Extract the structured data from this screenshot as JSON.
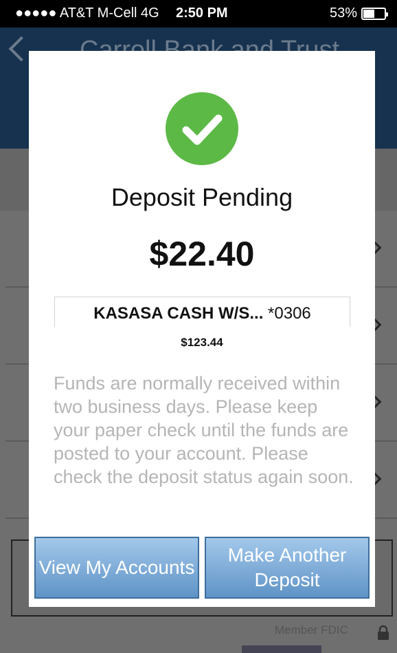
{
  "status_bar": {
    "carrier": "●●●●● AT&T M-Cell  4G",
    "time": "2:50 PM",
    "battery": "53%",
    "battery_level": 0.53
  },
  "background": {
    "header_title": "Carroll Bank and Trust",
    "footer_text": "Member FDIC"
  },
  "modal": {
    "title": "Deposit Pending",
    "amount": "$22.40",
    "account_name": "KASASA CASH W/S...",
    "account_number": "*0306",
    "balance": "$123.44",
    "message": "Funds are normally received within two business days. Please keep your paper check until the funds are posted to your account. Please check the deposit status again soon.",
    "buttons": {
      "view_accounts": "View My Accounts",
      "make_deposit": "Make Another Deposit"
    }
  },
  "colors": {
    "success": "#5cb946",
    "button_top": "#a3c8ea",
    "button_bottom": "#5f93c7",
    "header": "#17324f"
  }
}
